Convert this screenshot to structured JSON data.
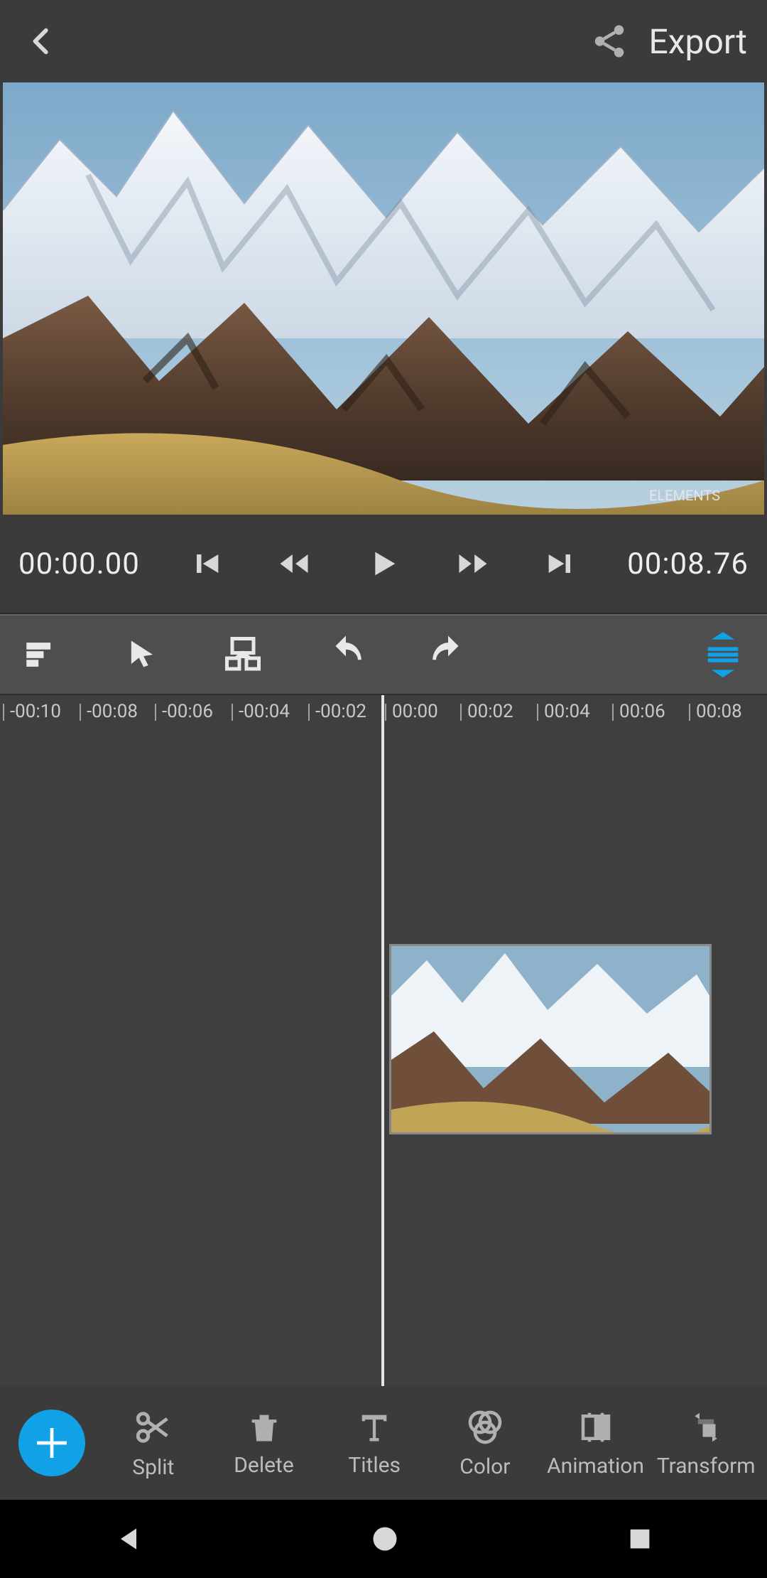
{
  "header": {
    "export_label": "Export"
  },
  "playback": {
    "current_time": "00:00.00",
    "total_time": "00:08.76"
  },
  "timeline": {
    "ticks": [
      "-00:10",
      "-00:08",
      "-00:06",
      "-00:04",
      "-00:02",
      "00:00",
      "00:02",
      "00:04",
      "00:06",
      "00:08"
    ]
  },
  "tools": {
    "split": "Split",
    "delete": "Delete",
    "titles": "Titles",
    "color": "Color",
    "animation": "Animation",
    "transform": "Transform"
  },
  "icons": {
    "back": "back-icon",
    "share": "share-icon",
    "prev": "skip-previous-icon",
    "rewind": "fast-rewind-icon",
    "play": "play-icon",
    "forward": "fast-forward-icon",
    "next": "skip-next-icon",
    "tracks": "track-list-icon",
    "pointer": "pointer-icon",
    "storyboard": "storyboard-icon",
    "undo": "undo-icon",
    "redo": "redo-icon",
    "expand": "expand-vertical-icon",
    "add": "plus-icon",
    "split_icon": "scissors-icon",
    "delete_icon": "trash-icon",
    "titles_icon": "text-icon",
    "color_icon": "color-rings-icon",
    "animation_icon": "animation-icon",
    "transform_icon": "transform-icon"
  },
  "colors": {
    "accent": "#10a1e6",
    "bg": "#3b3b3b",
    "toolbar": "#4e4e4e",
    "icon": "#d8d8d8",
    "icon_muted": "#b0b0b0"
  },
  "preview_watermark": "ELEMENTS"
}
